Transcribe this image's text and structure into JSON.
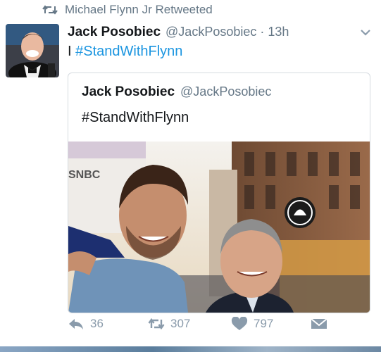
{
  "retweet_banner": {
    "text": "Michael Flynn Jr Retweeted",
    "icon": "retweet-icon"
  },
  "tweet": {
    "author_name": "Jack Posobiec",
    "author_handle": "@JackPosobiec",
    "separator": "·",
    "time": "13h",
    "text_prefix": "I",
    "hashtag": "#StandWithFlynn",
    "menu_icon": "chevron-down-icon"
  },
  "quoted_tweet": {
    "author_name": "Jack Posobiec",
    "author_handle": "@JackPosobiec",
    "text": "#StandWithFlynn",
    "photo_sign": "SNBC"
  },
  "actions": {
    "reply_count": "36",
    "retweet_count": "307",
    "like_count": "797",
    "reply_icon": "reply-icon",
    "retweet_icon": "retweet-icon",
    "like_icon": "heart-icon",
    "dm_icon": "envelope-icon"
  },
  "colors": {
    "link": "#1b95e0",
    "muted": "#657786",
    "action": "#8a9bab",
    "border": "#d6dbe0"
  }
}
